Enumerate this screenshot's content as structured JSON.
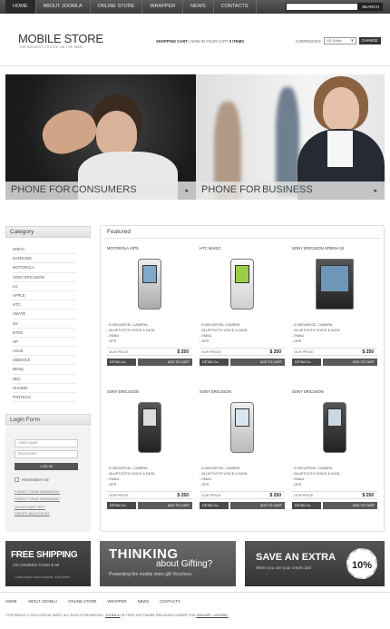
{
  "nav": {
    "items": [
      "HOME",
      "ABOUT JOOMLA",
      "ONLINE STORE",
      "WRAPPER",
      "NEWS",
      "CONTACTS"
    ],
    "search_label": "SEARCH"
  },
  "header": {
    "logo": "MOBILE STORE",
    "tagline": "THE BIGGEST CHOICE ON THE WEB",
    "cart_label": "SHOPPING CART",
    "cart_text": "NOW IN YOUR CART",
    "cart_count": "0 ITEMS",
    "currencies_label": "CURRENCIES",
    "currency_value": "US Dollar",
    "change_label": "CHANGE"
  },
  "hero": {
    "left": {
      "prefix": "PHONE FOR",
      "big": "CONSUMERS"
    },
    "right": {
      "prefix": "PHONE FOR",
      "big": "BUSINESS"
    }
  },
  "sidebar": {
    "category_title": "Category",
    "categories": [
      "NOKIA",
      "SAMSUNG",
      "MOTOROLA",
      "SONY ERICSSON",
      "LG",
      "APPLE",
      "HTC",
      "AMATE",
      "O2",
      "ETEN",
      "HP",
      "ASUS",
      "SIDEKICK",
      "BENQ",
      "NEC",
      "HUAWEI",
      "PANTECH"
    ],
    "login_title": "Login Form",
    "username_placeholder": "USER NAME",
    "password_placeholder": "PASSWORD",
    "login_button": "LOG IN",
    "remember_me": "REMEMBER ME",
    "forgot_password": "FORGOT YOUR PASSWORD?",
    "forgot_username": "FORGOT YOUR USERNAME?",
    "no_account": "NO ACCOUNT YET?",
    "create_account": "CREATE AN ACCOUNT"
  },
  "featured": {
    "title": "Featured",
    "price_label": "OUR PRICE:",
    "details_label": "DETAILS",
    "add_label": "ADD TO CART",
    "products": [
      {
        "name": "MOTOROLA V875",
        "features": [
          "- 8 MEGAPIXEL CAMERA",
          "- BLUETOOTH VOICE & DATA",
          "- EMAIL",
          "- GPS"
        ],
        "price": "$ 250"
      },
      {
        "name": "HTC MAGIC",
        "features": [
          "- 8 MEGAPIXEL CAMERA",
          "- BLUETOOTH VOICE & DATA",
          "- EMAIL",
          "- GPS"
        ],
        "price": "$ 250"
      },
      {
        "name": "SONY ERICSSON XPERIA X2",
        "features": [
          "- 8 MEGAPIXEL CAMERA",
          "- BLUETOOTH VOICE & DATA",
          "- EMAIL",
          "- GPS"
        ],
        "price": "$ 250"
      },
      {
        "name": "SONY ERICSSON",
        "features": [
          "- 8 MEGAPIXEL CAMERA",
          "- BLUETOOTH VOICE & DATA",
          "- EMAIL",
          "- GPS"
        ],
        "price": "$ 250"
      },
      {
        "name": "SONY ERICSSON",
        "features": [
          "- 8 MEGAPIXEL CAMERA",
          "- BLUETOOTH VOICE & DATA",
          "- EMAIL",
          "- GPS"
        ],
        "price": "$ 250"
      },
      {
        "name": "SONY ERICSSON",
        "features": [
          "- 8 MEGAPIXEL CAMERA",
          "- BLUETOOTH VOICE & DATA",
          "- EMAIL",
          "- GPS"
        ],
        "price": "$ 250"
      }
    ]
  },
  "banners": {
    "shipping_title": "FREE SHIPPING",
    "shipping_sub": "ON ORDERS OVER $ 99",
    "shipping_link": "Lorem ipsum dolor sit amet, dolor Reos",
    "gifting_title": "THINKING",
    "gifting_title2": "about Gifting?",
    "gifting_sub": "Presenting the mobile store gift Vouchers",
    "extra_title": "SAVE AN EXTRA",
    "extra_sub": "When you use your credit card",
    "extra_badge": "10%"
  },
  "footer": {
    "links": [
      "HOME",
      "ABOUT JOOMLA",
      "ONLINE STORE",
      "WRAPPER",
      "NEWS",
      "CONTACTS"
    ],
    "copyright_a": "COPYRIGHT © 2010 VIRTUE MART. ALL RIGHTS RESERVED.",
    "copyright_joomla": "JOOMLA!",
    "copyright_b": "IS FREE SOFTWARE RELEASED UNDER THE",
    "copyright_license": "GNU/GPL LICENSE."
  }
}
